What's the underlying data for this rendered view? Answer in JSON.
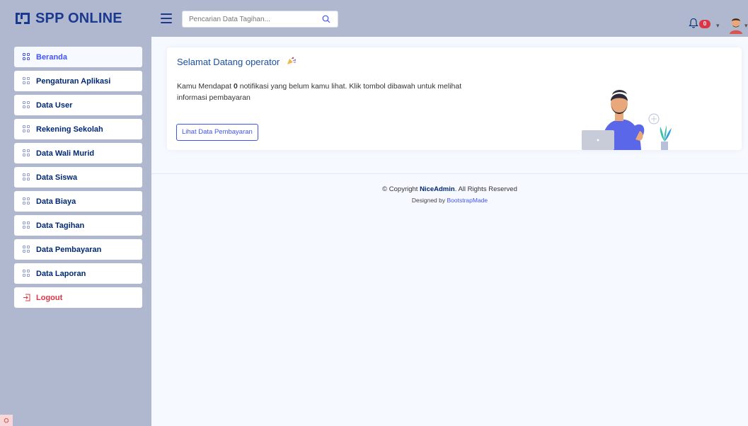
{
  "header": {
    "app_title": "SPP ONLINE",
    "search_placeholder": "Pencarian Data Tagihan...",
    "notification_count": "0",
    "brand_color": "#1b3a8f"
  },
  "sidebar": {
    "items": [
      {
        "label": "Beranda",
        "active": true
      },
      {
        "label": "Pengaturan Aplikasi"
      },
      {
        "label": "Data User"
      },
      {
        "label": "Rekening Sekolah"
      },
      {
        "label": "Data Wali Murid"
      },
      {
        "label": "Data Siswa"
      },
      {
        "label": "Data Biaya"
      },
      {
        "label": "Data Tagihan"
      },
      {
        "label": "Data Pembayaran"
      },
      {
        "label": "Data Laporan"
      }
    ],
    "logout_label": "Logout"
  },
  "welcome_card": {
    "title": "Selamat Datang operator",
    "text_before": "Kamu Mendapat ",
    "count": "0",
    "text_after": " notifikasi yang belum kamu lihat. Klik tombol dibawah untuk melihat informasi pembayaran",
    "button_label": "Lihat Data Pembayaran"
  },
  "footer": {
    "copyright_prefix": "© Copyright ",
    "brand": "NiceAdmin",
    "copyright_suffix": ". All Rights Reserved",
    "designed_prefix": "Designed by ",
    "designer": "BootstrapMade"
  }
}
